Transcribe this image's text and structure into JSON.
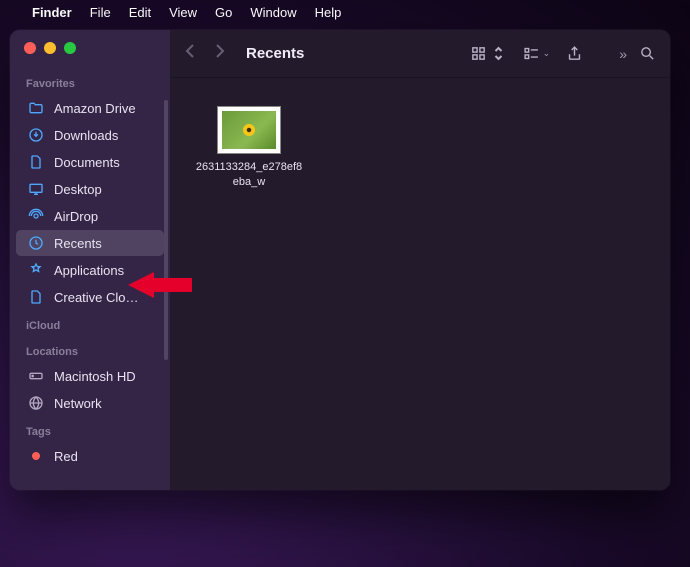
{
  "menubar": {
    "app": "Finder",
    "items": [
      "File",
      "Edit",
      "View",
      "Go",
      "Window",
      "Help"
    ]
  },
  "window": {
    "title": "Recents"
  },
  "sidebar": {
    "sections": [
      {
        "header": "Favorites",
        "items": [
          {
            "icon": "folder",
            "label": "Amazon Drive"
          },
          {
            "icon": "download",
            "label": "Downloads"
          },
          {
            "icon": "document",
            "label": "Documents"
          },
          {
            "icon": "desktop",
            "label": "Desktop"
          },
          {
            "icon": "airdrop",
            "label": "AirDrop"
          },
          {
            "icon": "clock",
            "label": "Recents",
            "selected": true
          },
          {
            "icon": "apps",
            "label": "Applications"
          },
          {
            "icon": "file",
            "label": "Creative Clo…"
          }
        ]
      },
      {
        "header": "iCloud",
        "items": []
      },
      {
        "header": "Locations",
        "items": [
          {
            "icon": "disk",
            "label": "Macintosh HD"
          },
          {
            "icon": "globe",
            "label": "Network"
          }
        ]
      },
      {
        "header": "Tags",
        "items": [
          {
            "icon": "dot-red",
            "label": "Red"
          }
        ]
      }
    ]
  },
  "files": [
    {
      "name": "2631133284_e278ef8eba_w"
    }
  ],
  "annotation": {
    "arrow_target": "Applications"
  }
}
